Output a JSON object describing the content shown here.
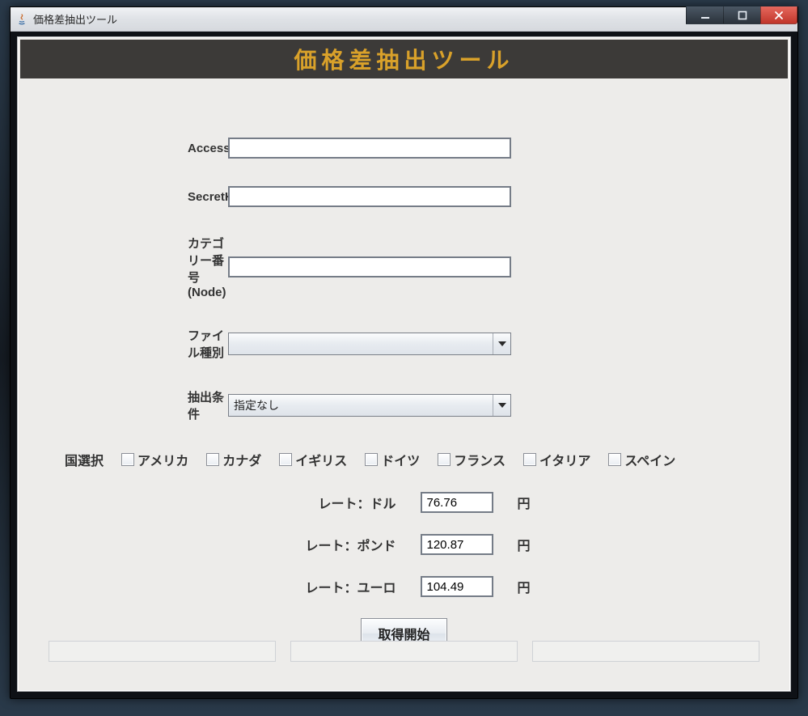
{
  "window": {
    "title": "価格差抽出ツール"
  },
  "banner": {
    "text": "価格差抽出ツール"
  },
  "fields": {
    "accessKeyId": {
      "label": "AccessKeyId",
      "value": ""
    },
    "secretKey": {
      "label": "SecretKey",
      "value": ""
    },
    "categoryNode": {
      "label": "カテゴリー番号(Node)",
      "value": ""
    },
    "fileType": {
      "label": "ファイル種別",
      "value": ""
    },
    "filter": {
      "label": "抽出条件",
      "value": "指定なし"
    }
  },
  "countries": {
    "label": "国選択",
    "items": [
      {
        "label": "アメリカ"
      },
      {
        "label": "カナダ"
      },
      {
        "label": "イギリス"
      },
      {
        "label": "ドイツ"
      },
      {
        "label": "フランス"
      },
      {
        "label": "イタリア"
      },
      {
        "label": "スペイン"
      }
    ]
  },
  "rates": {
    "suffix": "円",
    "dollar": {
      "label": "レート：ドル",
      "value": "76.76"
    },
    "pound": {
      "label": "レート：ポンド",
      "value": "120.87"
    },
    "euro": {
      "label": "レート：ユーロ",
      "value": "104.49"
    }
  },
  "actions": {
    "start": "取得開始"
  },
  "status": {
    "left": "",
    "middle": "",
    "right": ""
  }
}
